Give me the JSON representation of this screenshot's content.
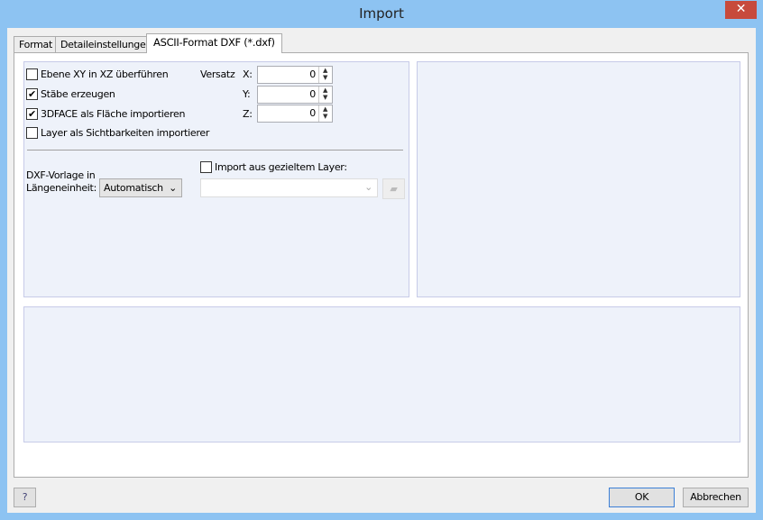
{
  "window": {
    "title": "Import",
    "close_icon": "close-icon"
  },
  "tabs": [
    {
      "label": "Format"
    },
    {
      "label": "Detaileinstellungen"
    },
    {
      "label": "ASCII-Format DXF (*.dxf)",
      "active": true
    }
  ],
  "options": {
    "checkboxes": [
      {
        "label": "Ebene XY in XZ überführen",
        "checked": false
      },
      {
        "label": "Stäbe erzeugen",
        "checked": true
      },
      {
        "label": "3DFACE als Fläche importieren",
        "checked": true
      },
      {
        "label": "Layer als Sichtbarkeiten importierer",
        "checked": false
      }
    ],
    "offset": {
      "label": "Versatz",
      "x_label": "X:",
      "x": "0",
      "y_label": "Y:",
      "y": "0",
      "z_label": "Z:",
      "z": "0"
    },
    "unit": {
      "label": "DXF-Vorlage in Längeneinheit:",
      "value": "Automatisch"
    },
    "layer": {
      "label": "Import aus gezieltem Layer:",
      "checked": false,
      "value": ""
    }
  },
  "footer": {
    "ok": "OK",
    "cancel": "Abbrechen"
  }
}
